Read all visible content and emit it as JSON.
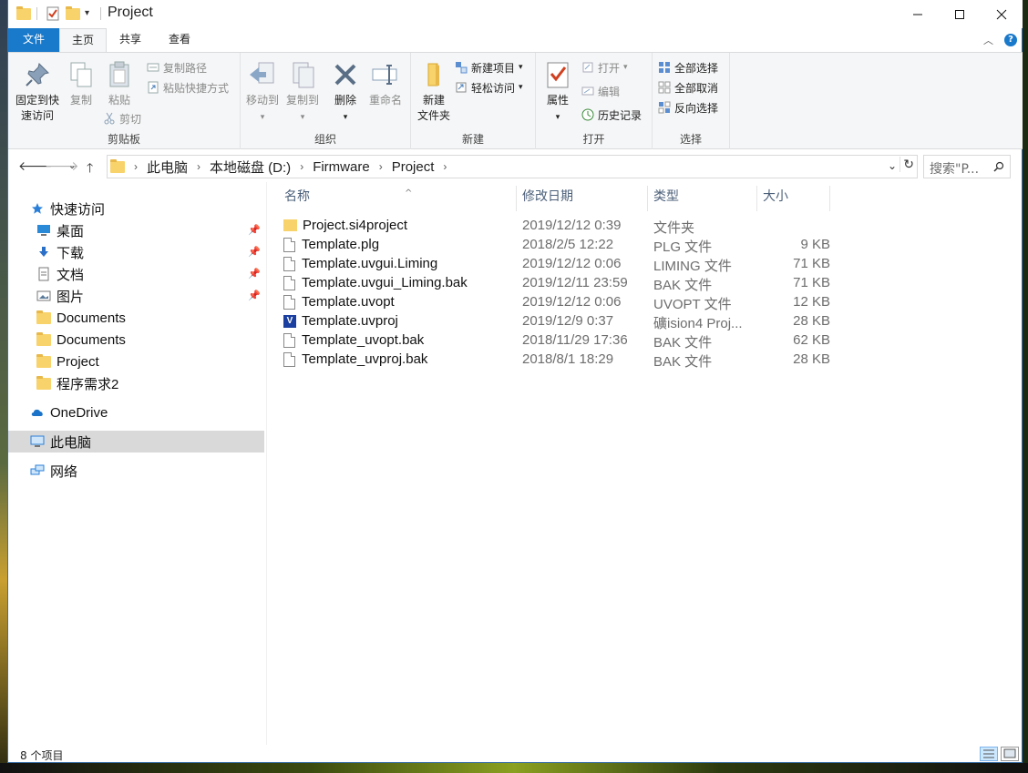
{
  "window": {
    "title": "Project"
  },
  "tabs": [
    {
      "label": "文件"
    },
    {
      "label": "主页"
    },
    {
      "label": "共享"
    },
    {
      "label": "查看"
    }
  ],
  "ribbon": {
    "clipboard": {
      "label": "剪贴板",
      "pin_quick_access_line1": "固定到快",
      "pin_quick_access_line2": "速访问",
      "copy": "复制",
      "paste": "粘贴",
      "copy_path": "复制路径",
      "paste_shortcut": "粘贴快捷方式",
      "cut": "剪切"
    },
    "organize": {
      "label": "组织",
      "move_to": "移动到",
      "copy_to": "复制到",
      "delete": "删除",
      "rename": "重命名"
    },
    "new": {
      "label": "新建",
      "new_folder_line1": "新建",
      "new_folder_line2": "文件夹",
      "new_item": "新建项目",
      "easy_access": "轻松访问"
    },
    "open": {
      "label": "打开",
      "properties": "属性",
      "open": "打开",
      "edit": "编辑",
      "history": "历史记录"
    },
    "select": {
      "label": "选择",
      "select_all": "全部选择",
      "select_none": "全部取消",
      "invert": "反向选择"
    }
  },
  "address": {
    "crumbs": [
      "此电脑",
      "本地磁盘 (D:)",
      "Firmware",
      "Project"
    ],
    "search_placeholder": "搜索\"P..."
  },
  "navpane": {
    "quick_access": "快速访问",
    "items": [
      {
        "label": "桌面",
        "pinned": true
      },
      {
        "label": "下载",
        "pinned": true
      },
      {
        "label": "文档",
        "pinned": true
      },
      {
        "label": "图片",
        "pinned": true
      },
      {
        "label": "Documents",
        "pinned": false
      },
      {
        "label": "Documents",
        "pinned": false
      },
      {
        "label": "Project",
        "pinned": false
      },
      {
        "label": "程序需求2",
        "pinned": false
      }
    ],
    "onedrive": "OneDrive",
    "this_pc": "此电脑",
    "network": "网络"
  },
  "columns": {
    "name": "名称",
    "date": "修改日期",
    "type": "类型",
    "size": "大小"
  },
  "files": [
    {
      "name": "Project.si4project",
      "date": "2019/12/12 0:39",
      "type": "文件夹",
      "size": "",
      "icon": "folder-icon"
    },
    {
      "name": "Template.plg",
      "date": "2018/2/5 12:22",
      "type": "PLG 文件",
      "size": "9 KB",
      "icon": "file-icon"
    },
    {
      "name": "Template.uvgui.Liming",
      "date": "2019/12/12 0:06",
      "type": "LIMING 文件",
      "size": "71 KB",
      "icon": "file-icon"
    },
    {
      "name": "Template.uvgui_Liming.bak",
      "date": "2019/12/11 23:59",
      "type": "BAK 文件",
      "size": "71 KB",
      "icon": "file-icon"
    },
    {
      "name": "Template.uvopt",
      "date": "2019/12/12 0:06",
      "type": "UVOPT 文件",
      "size": "12 KB",
      "icon": "file-icon"
    },
    {
      "name": "Template.uvproj",
      "date": "2019/12/9 0:37",
      "type": "礦ision4 Proj...",
      "size": "28 KB",
      "icon": "uvision-icon"
    },
    {
      "name": "Template_uvopt.bak",
      "date": "2018/11/29 17:36",
      "type": "BAK 文件",
      "size": "62 KB",
      "icon": "file-icon"
    },
    {
      "name": "Template_uvproj.bak",
      "date": "2018/8/1 18:29",
      "type": "BAK 文件",
      "size": "28 KB",
      "icon": "file-icon"
    }
  ],
  "status": {
    "count": "8 个项目"
  }
}
